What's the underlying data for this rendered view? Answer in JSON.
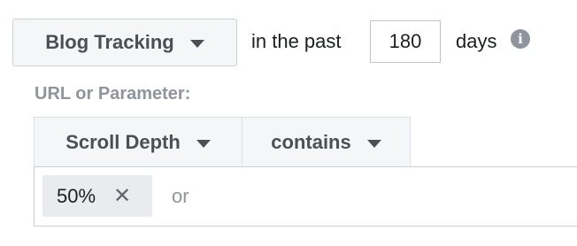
{
  "filter": {
    "source": {
      "label": "Blog Tracking"
    },
    "timeframe_prefix": "in the past",
    "days_value": "180",
    "timeframe_suffix": "days",
    "info_icon": "info-icon"
  },
  "rule": {
    "section_label": "URL or Parameter:",
    "field": {
      "label": "Scroll Depth"
    },
    "operator": {
      "label": "contains"
    },
    "values": [
      {
        "label": "50%",
        "remove_glyph": "✕"
      }
    ],
    "or_placeholder": "or"
  },
  "colors": {
    "button_bg": "#f5f6f7",
    "button_text": "#4b4f56",
    "muted_text": "#90949c",
    "border": "#ccd0d5",
    "token_bg": "#e9ebee",
    "info_icon": "#8d949e"
  }
}
